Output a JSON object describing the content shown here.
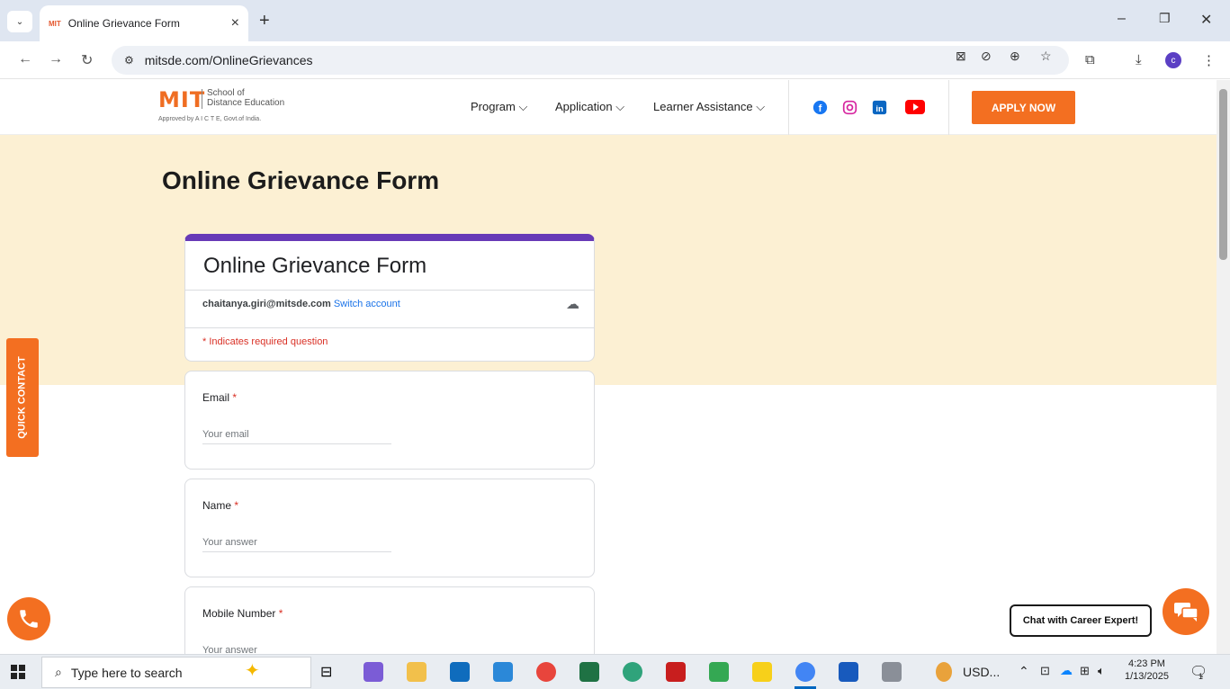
{
  "browser": {
    "tab_title": "Online Grievance Form",
    "tab_favicon_text": "MIT",
    "url": "mitsde.com/OnlineGrievances",
    "profile_initial": "c"
  },
  "site": {
    "logo_mit": "MIT",
    "logo_school_line1": "School of",
    "logo_school_line2": "Distance Education",
    "logo_approved": "Approved by A I C T E, Govt.of India.",
    "nav": {
      "program": "Program",
      "application": "Application",
      "learner_assistance": "Learner Assistance"
    },
    "social": [
      "facebook",
      "instagram",
      "linkedin",
      "youtube"
    ],
    "apply_now": "APPLY NOW",
    "quick_contact": "QUICK CONTACT",
    "chat_label": "Chat with Career Expert!"
  },
  "page": {
    "title": "Online Grievance Form"
  },
  "form": {
    "title": "Online Grievance Form",
    "account_email": "chaitanya.giri@mitsde.com",
    "switch_account": "Switch account",
    "required_note": "* Indicates required question",
    "questions": [
      {
        "label": "Email",
        "required_mark": "*",
        "placeholder": "Your email"
      },
      {
        "label": "Name",
        "required_mark": "*",
        "placeholder": "Your answer"
      },
      {
        "label": "Mobile Number",
        "required_mark": "*",
        "placeholder": "Your answer"
      }
    ]
  },
  "taskbar": {
    "search_placeholder": "Type here to search",
    "usd_label": "USD...",
    "time": "4:23 PM",
    "date": "1/13/2025",
    "notification_count": "1"
  },
  "colors": {
    "brand_orange": "#f36f21",
    "form_accent": "#673ab7",
    "hero_bg": "#fcf0d3"
  }
}
